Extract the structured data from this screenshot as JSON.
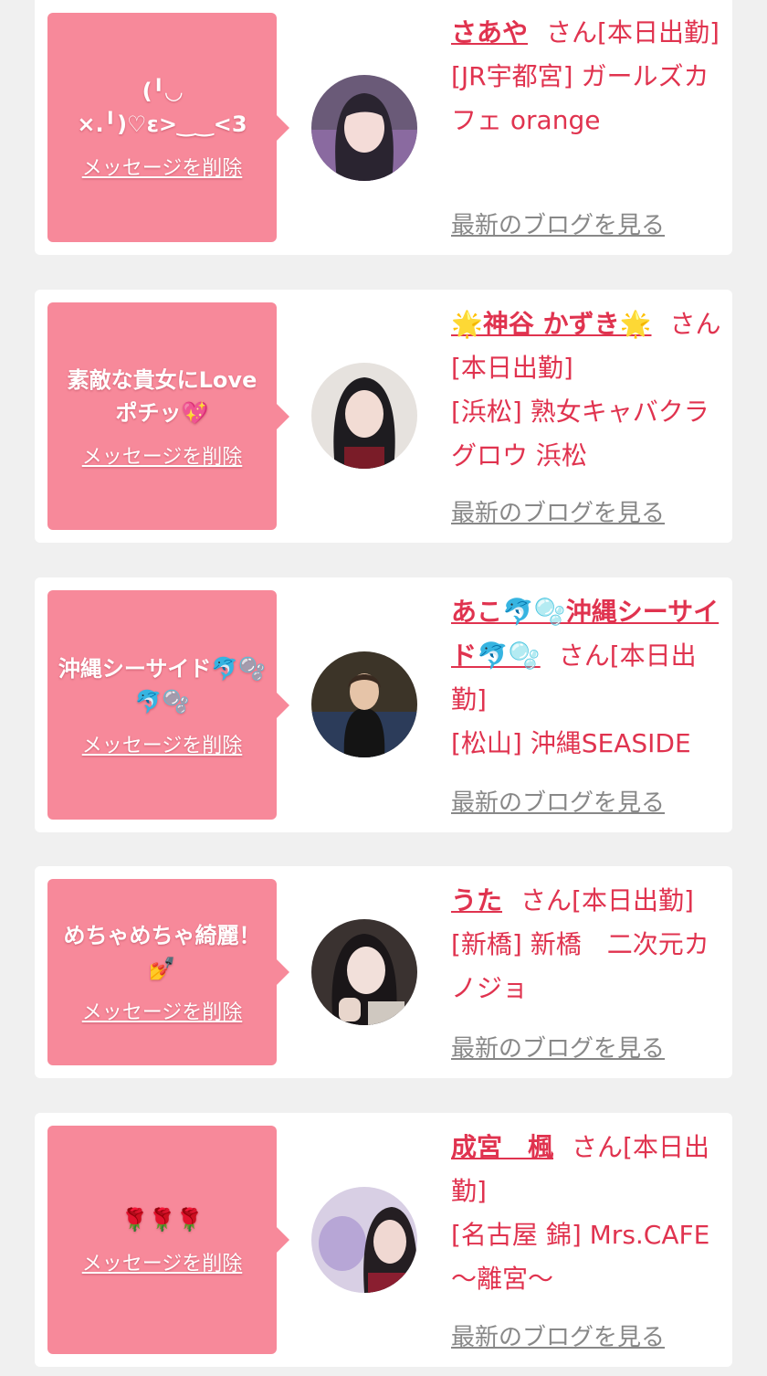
{
  "cards": [
    {
      "message": "(╹◡ ×.╹)♡ε>‿‿<3",
      "delete_label": "メッセージを削除",
      "name": "さあや",
      "suffix": "さん[本日出勤]",
      "shop": "[JR宇都宮] ガールズカフェ orange",
      "blog_label": "最新のブログを見る"
    },
    {
      "message": "素敵な貴女にLoveポチッ💖",
      "delete_label": "メッセージを削除",
      "name": "🌟神谷 かずき🌟",
      "suffix": "さん[本日出勤]",
      "shop": "[浜松] 熟女キャバクラグロウ 浜松",
      "blog_label": "最新のブログを見る"
    },
    {
      "message": "沖縄シーサイド🐬🫧🐬🫧",
      "delete_label": "メッセージを削除",
      "name": "あこ🐬🫧沖縄シーサイド🐬🫧",
      "suffix": "さん[本日出勤]",
      "shop": "[松山] 沖縄SEASIDE",
      "blog_label": "最新のブログを見る"
    },
    {
      "message": "めちゃめちゃ綺麗！💅",
      "delete_label": "メッセージを削除",
      "name": "うた",
      "suffix": "さん[本日出勤]",
      "shop": "[新橋] 新橋　二次元カノジョ",
      "blog_label": "最新のブログを見る"
    },
    {
      "message": "🌹🌹🌹",
      "delete_label": "メッセージを削除",
      "name": "成宮　楓",
      "suffix": "さん[本日出勤]",
      "shop": "[名古屋 錦] Mrs.CAFE～離宮～",
      "blog_label": "最新のブログを見る"
    }
  ],
  "colors": {
    "bubble": "#f7899a",
    "accent": "#e0334f",
    "link_gray": "#888888",
    "background": "#f0f0f0"
  }
}
